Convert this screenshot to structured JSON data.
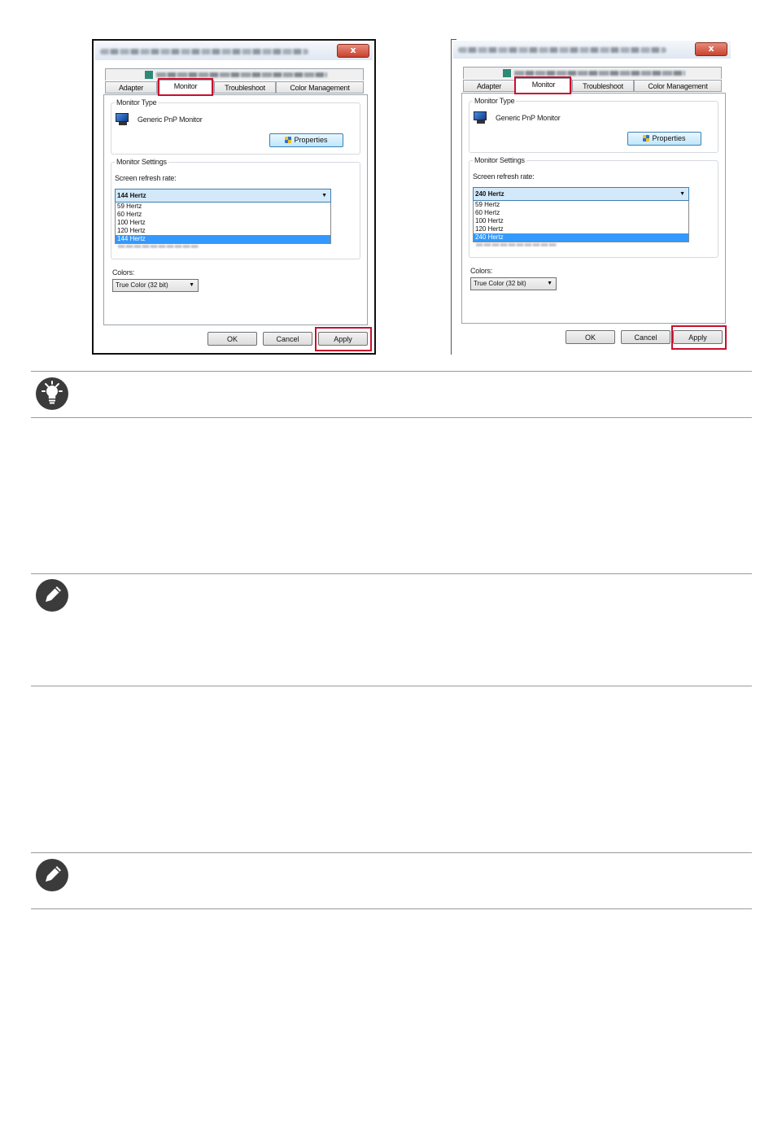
{
  "dialogs": [
    {
      "close_label": "x",
      "tabs": [
        "Adapter",
        "Monitor",
        "Troubleshoot",
        "Color Management"
      ],
      "active_tab": "Monitor",
      "monitor_type_label": "Monitor Type",
      "monitor_name": "Generic PnP Monitor",
      "properties_button": "Properties",
      "monitor_settings_label": "Monitor Settings",
      "refresh_rate_label": "Screen refresh rate:",
      "selected_rate": "144 Hertz",
      "rate_options": [
        "59 Hertz",
        "60 Hertz",
        "100 Hertz",
        "120 Hertz",
        "144 Hertz"
      ],
      "colors_label": "Colors:",
      "colors_value": "True Color (32 bit)",
      "ok_button": "OK",
      "cancel_button": "Cancel",
      "apply_button": "Apply"
    },
    {
      "close_label": "x",
      "tabs": [
        "Adapter",
        "Monitor",
        "Troubleshoot",
        "Color Management"
      ],
      "active_tab": "Monitor",
      "monitor_type_label": "Monitor Type",
      "monitor_name": "Generic PnP Monitor",
      "properties_button": "Properties",
      "monitor_settings_label": "Monitor Settings",
      "refresh_rate_label": "Screen refresh rate:",
      "selected_rate": "240 Hertz",
      "rate_options": [
        "59 Hertz",
        "60 Hertz",
        "100 Hertz",
        "120 Hertz",
        "240 Hertz"
      ],
      "colors_label": "Colors:",
      "colors_value": "True Color (32 bit)",
      "ok_button": "OK",
      "cancel_button": "Cancel",
      "apply_button": "Apply"
    }
  ],
  "highlight_color": "#c8102e",
  "notes": [
    {
      "icon": "lightbulb-icon"
    },
    {
      "icon": "pencil-icon"
    },
    {
      "icon": "pencil-icon"
    }
  ]
}
